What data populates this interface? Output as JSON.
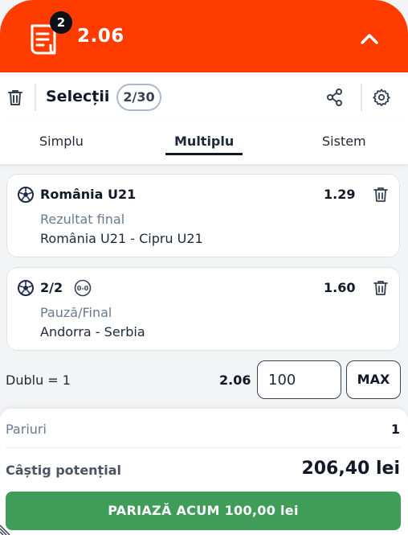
{
  "header": {
    "selection_count": "2",
    "total_odds": "2.06",
    "brand_color": "#fe3c00"
  },
  "selections_bar": {
    "title": "Selecții",
    "count": "2/30"
  },
  "tabs": [
    {
      "label": "Simplu",
      "active": false
    },
    {
      "label": "Multiplu",
      "active": true
    },
    {
      "label": "Sistem",
      "active": false
    }
  ],
  "bets": [
    {
      "selection": "România U21",
      "odds": "1.29",
      "market": "Rezultat final",
      "event": "România U21 - Cipru U21",
      "icon": "soccer-ball-icon"
    },
    {
      "selection": "2/2",
      "odds": "1.60",
      "market": "Pauză/Final",
      "event": "Andorra - Serbia",
      "icon": "soccer-ball-icon",
      "extra_icon": "score-icon",
      "score_glyph": "0-0"
    }
  ],
  "combo": {
    "label": "Dublu = 1",
    "odds": "2.06",
    "stake_value": "100",
    "max_label": "MAX"
  },
  "summary": {
    "bets_label": "Pariuri",
    "bets_value": "1",
    "win_label": "Câștig potențial",
    "win_value": "206,40 lei",
    "place_bet_label": "PARIAZĂ ACUM 100,00 lei",
    "place_bet_color": "#3f9c59"
  }
}
